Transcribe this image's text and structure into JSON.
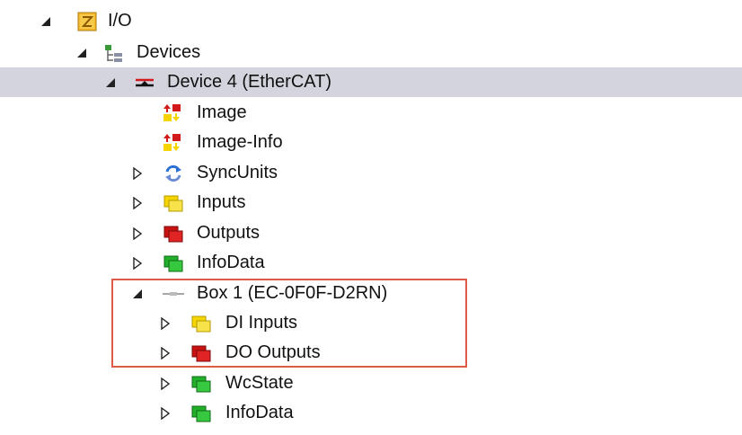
{
  "tree": {
    "io": {
      "label": "I/O",
      "state": "expanded"
    },
    "devices": {
      "label": "Devices",
      "state": "expanded"
    },
    "device4": {
      "label": "Device 4 (EtherCAT)",
      "state": "expanded",
      "selected": true
    },
    "image": {
      "label": "Image"
    },
    "image_info": {
      "label": "Image-Info"
    },
    "syncunits": {
      "label": "SyncUnits",
      "state": "collapsed"
    },
    "inputs": {
      "label": "Inputs",
      "state": "collapsed"
    },
    "outputs": {
      "label": "Outputs",
      "state": "collapsed"
    },
    "infodata": {
      "label": "InfoData",
      "state": "collapsed"
    },
    "box1": {
      "label": "Box 1 (EC-0F0F-D2RN)",
      "state": "expanded"
    },
    "di_inputs": {
      "label": "DI Inputs",
      "state": "collapsed"
    },
    "do_outputs": {
      "label": "DO Outputs",
      "state": "collapsed"
    },
    "wcstate": {
      "label": "WcState",
      "state": "collapsed"
    },
    "box_infodata": {
      "label": "InfoData",
      "state": "collapsed"
    }
  },
  "colors": {
    "selection": "#d3d4dd",
    "highlight_border": "#e05a48",
    "input_yellow": "#f5d400",
    "output_red": "#d21a1a",
    "info_green": "#22b02a"
  },
  "icons": {
    "io": "io-folder-icon",
    "devices": "devices-icon",
    "device4": "ethercat-device-icon",
    "image": "image-icon",
    "syncunits": "sync-icon",
    "inputs": "inputs-icon",
    "outputs": "outputs-icon",
    "infodata": "infodata-icon",
    "box": "box-icon"
  }
}
